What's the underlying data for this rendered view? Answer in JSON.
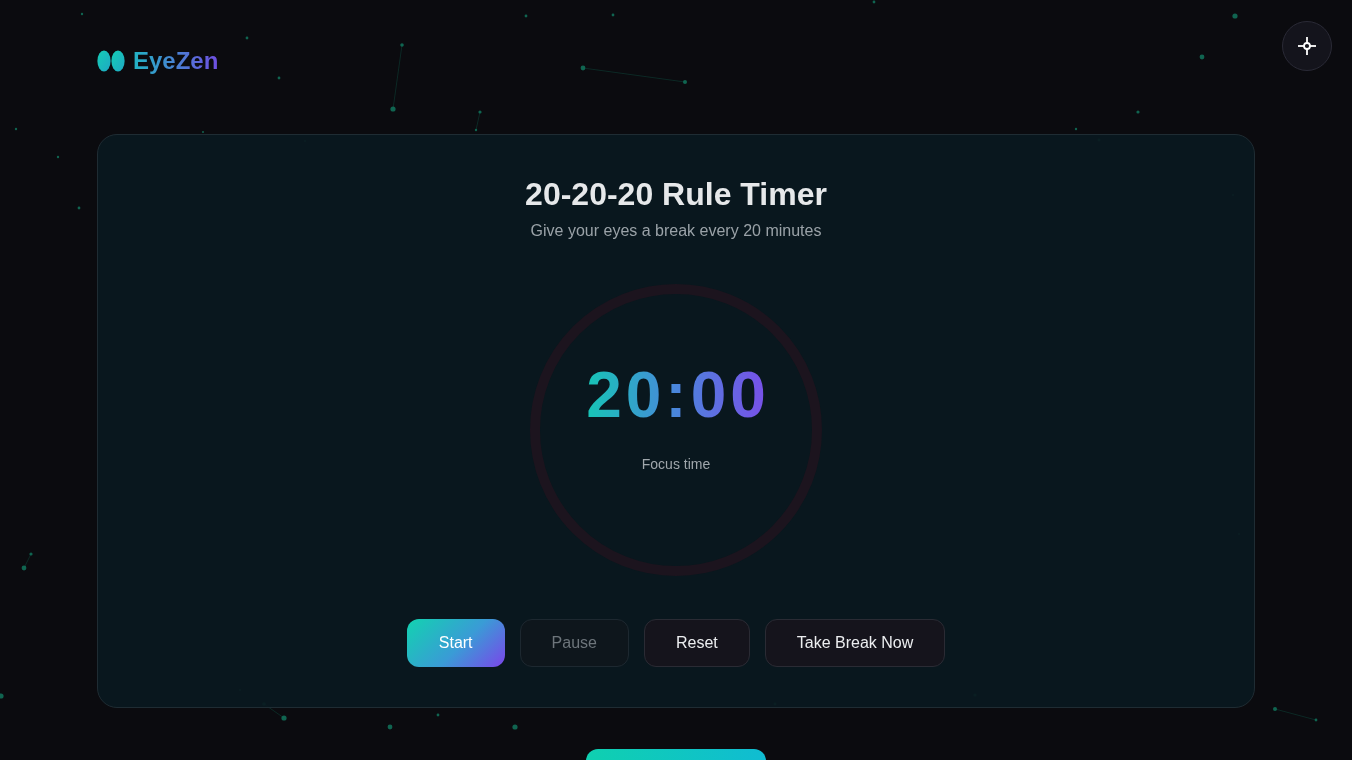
{
  "header": {
    "brand": "EyeZen"
  },
  "timer_card": {
    "title": "20-20-20 Rule Timer",
    "subtitle": "Give your eyes a break every 20 minutes",
    "time": "20:00",
    "phase_label": "Focus time",
    "buttons": [
      {
        "label": "Start",
        "kind": "primary",
        "disabled": false
      },
      {
        "label": "Pause",
        "kind": "secondary",
        "disabled": true
      },
      {
        "label": "Reset",
        "kind": "secondary",
        "disabled": false
      },
      {
        "label": "Take Break Now",
        "kind": "secondary",
        "disabled": false
      }
    ]
  }
}
